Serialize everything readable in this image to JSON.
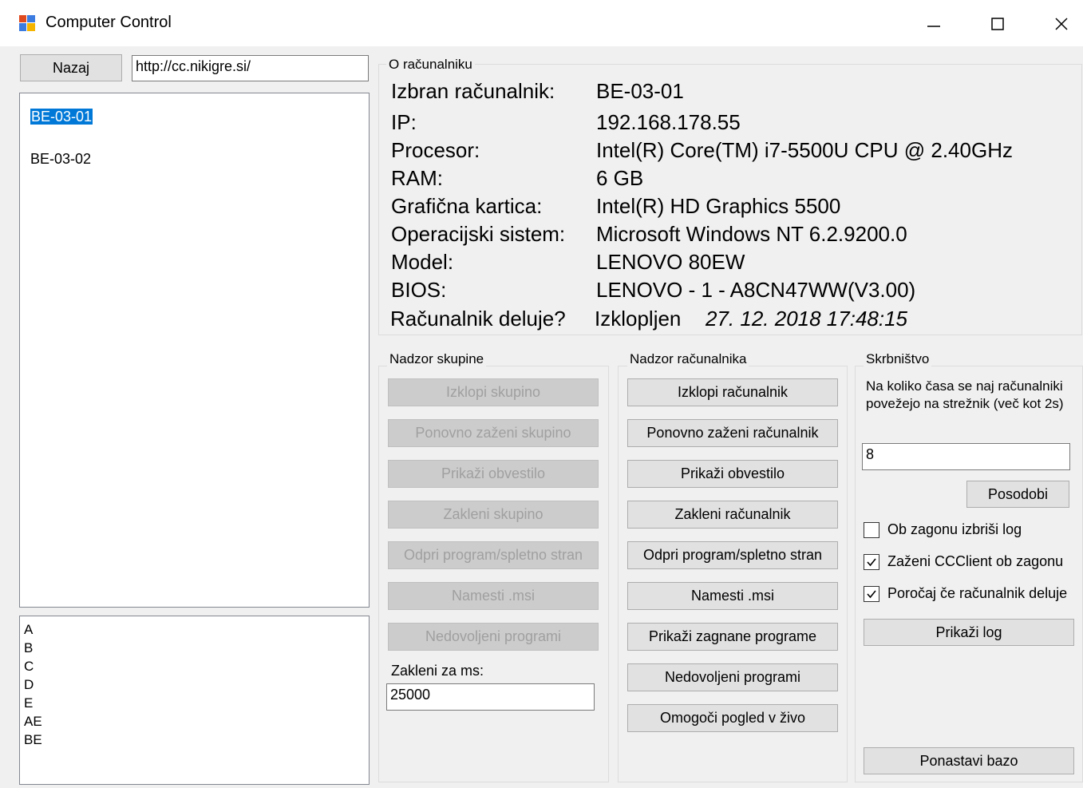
{
  "window": {
    "title": "Computer Control",
    "minimize": "—",
    "maximize": "☐",
    "close": "✕"
  },
  "left": {
    "back_label": "Nazaj",
    "url": "http://cc.nikigre.si/",
    "computers": [
      "BE-03-01",
      "BE-03-02"
    ],
    "selected": "BE-03-01",
    "groups": [
      "A",
      "B",
      "C",
      "D",
      "E",
      "AE",
      "BE"
    ]
  },
  "info": {
    "legend": "O računalniku",
    "rows": [
      {
        "label": "Izbran računalnik:",
        "value": "BE-03-01"
      },
      {
        "label": "IP:",
        "value": "192.168.178.55"
      },
      {
        "label": "Procesor:",
        "value": "Intel(R) Core(TM) i7-5500U CPU @ 2.40GHz"
      },
      {
        "label": "RAM:",
        "value": "6 GB"
      },
      {
        "label": "Grafična kartica:",
        "value": "Intel(R) HD Graphics 5500"
      },
      {
        "label": "Operacijski sistem:",
        "value": "Microsoft Windows NT 6.2.9200.0"
      },
      {
        "label": "Model:",
        "value": "LENOVO 80EW"
      },
      {
        "label": "BIOS:",
        "value": "LENOVO - 1 - A8CN47WW(V3.00)"
      }
    ],
    "status_label": "Računalnik deluje?",
    "status_value": "Izklopljen",
    "status_time": "27. 12. 2018 17:48:15"
  },
  "group_ctrl": {
    "legend": "Nadzor skupine",
    "buttons": [
      "Izklopi skupino",
      "Ponovno zaženi skupino",
      "Prikaži obvestilo",
      "Zakleni skupino",
      "Odpri program/spletno stran",
      "Namesti .msi",
      "Nedovoljeni programi"
    ],
    "lock_label": "Zakleni za ms:",
    "lock_value": "25000"
  },
  "pc_ctrl": {
    "legend": "Nadzor računalnika",
    "buttons": [
      "Izklopi računalnik",
      "Ponovno zaženi računalnik",
      "Prikaži obvestilo",
      "Zakleni računalnik",
      "Odpri program/spletno stran",
      "Namesti .msi",
      "Prikaži zagnane programe",
      "Nedovoljeni programi",
      "Omogoči pogled v živo"
    ]
  },
  "admin": {
    "legend": "Skrbništvo",
    "desc": "Na koliko časa se naj računalniki povežejo na strežnik (več kot 2s)",
    "interval": "8",
    "update_label": "Posodobi",
    "checkboxes": [
      {
        "label": "Ob zagonu izbriši log",
        "checked": false
      },
      {
        "label": "Zaženi CCClient ob zagonu",
        "checked": true
      },
      {
        "label": "Poročaj če računalnik deluje",
        "checked": true
      }
    ],
    "show_log_label": "Prikaži log",
    "reset_db_label": "Ponastavi bazo"
  }
}
